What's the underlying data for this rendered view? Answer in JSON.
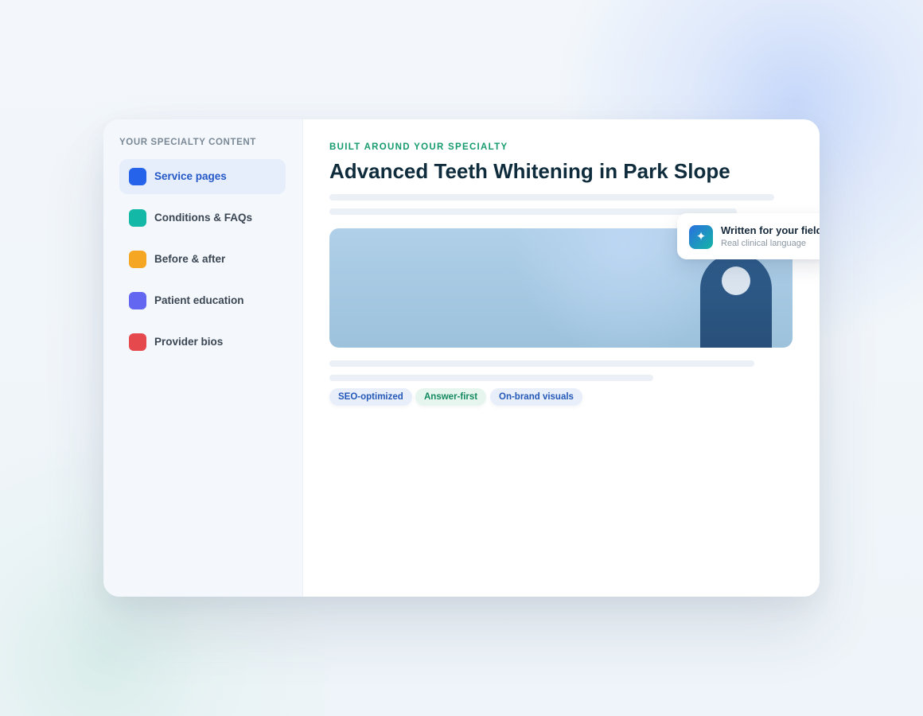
{
  "sidebar": {
    "heading": "YOUR SPECIALTY CONTENT",
    "items": [
      {
        "label": "Service pages",
        "color": "#2563eb",
        "active": true
      },
      {
        "label": "Conditions & FAQs",
        "color": "#14b8a6",
        "active": false
      },
      {
        "label": "Before & after",
        "color": "#f5a623",
        "active": false
      },
      {
        "label": "Patient education",
        "color": "#6366f1",
        "active": false
      },
      {
        "label": "Provider bios",
        "color": "#e5484d",
        "active": false
      }
    ]
  },
  "main": {
    "eyebrow": "BUILT AROUND YOUR SPECIALTY",
    "headline": "Advanced Teeth Whitening in Park Slope",
    "tags": [
      {
        "label": "SEO-optimized",
        "tone": "blue"
      },
      {
        "label": "Answer-first",
        "tone": "green"
      },
      {
        "label": "On-brand visuals",
        "tone": "blue"
      }
    ]
  },
  "badge": {
    "icon": "sparkle-icon",
    "glyph": "✦",
    "title": "Written for your field",
    "subtitle": "Real clinical language"
  },
  "colors": {
    "accent_blue": "#2458c6",
    "accent_green": "#169b6e",
    "headline": "#0f2c3d"
  }
}
